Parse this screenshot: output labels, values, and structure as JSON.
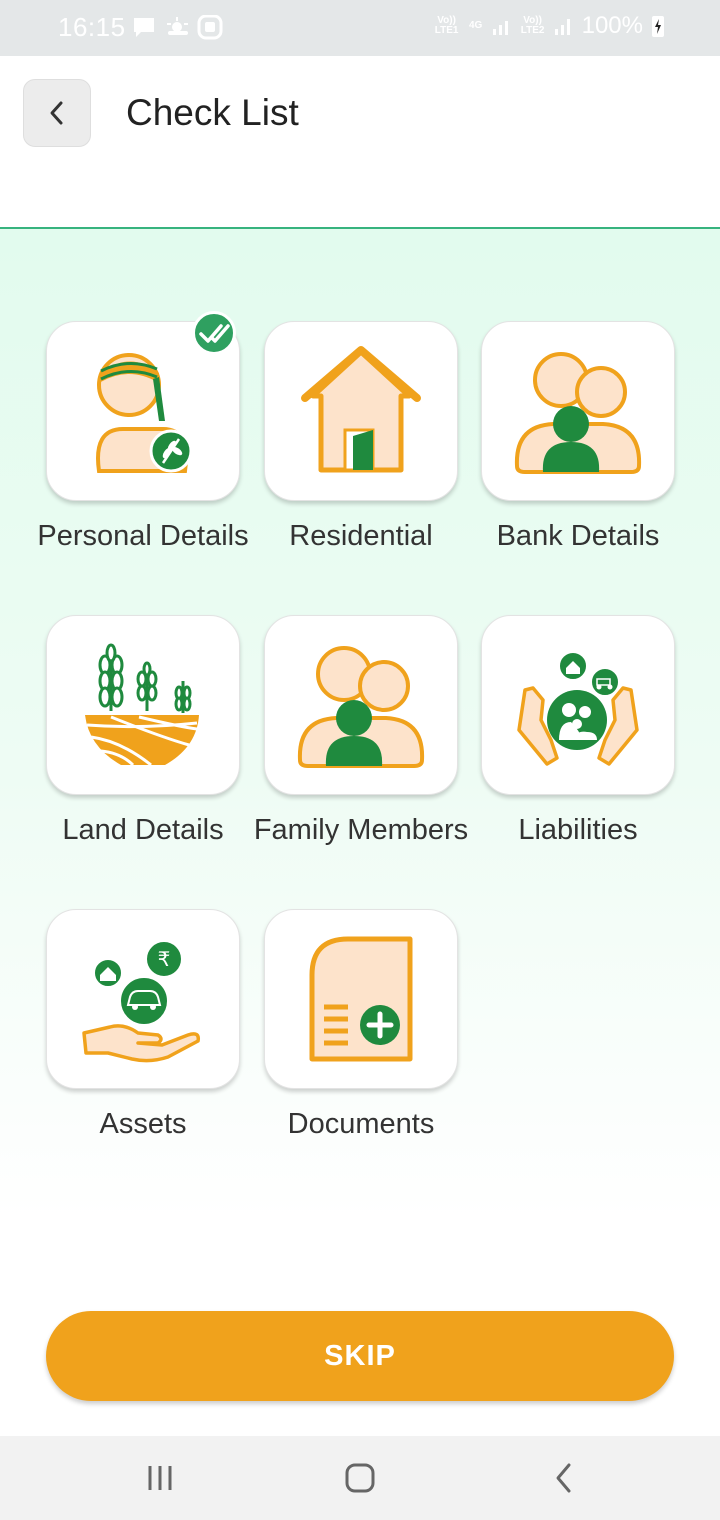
{
  "status_bar": {
    "time": "16:15",
    "battery": "100%",
    "sim1_label": "Vo)) LTE1",
    "net_label": "4G",
    "sim2_label": "Vo)) LTE2"
  },
  "header": {
    "title": "Check List",
    "back_icon": "chevron-left-icon"
  },
  "tiles": [
    {
      "label": "Personal Details",
      "icon": "farmer-icon",
      "completed": true
    },
    {
      "label": "Residential",
      "icon": "house-icon",
      "completed": false
    },
    {
      "label": "Bank Details",
      "icon": "people-group-icon",
      "completed": false
    },
    {
      "label": "Land Details",
      "icon": "crop-field-icon",
      "completed": false
    },
    {
      "label": "Family Members",
      "icon": "family-icon",
      "completed": false
    },
    {
      "label": "Liabilities",
      "icon": "hands-liabilities-icon",
      "completed": false
    },
    {
      "label": "Assets",
      "icon": "hand-assets-icon",
      "completed": false
    },
    {
      "label": "Documents",
      "icon": "document-add-icon",
      "completed": false
    }
  ],
  "skip_button": "SKIP",
  "colors": {
    "accent_orange": "#f0a21c",
    "accent_green": "#1f8a3e",
    "check_green": "#2fa060",
    "icon_fill": "#fde3cb"
  }
}
